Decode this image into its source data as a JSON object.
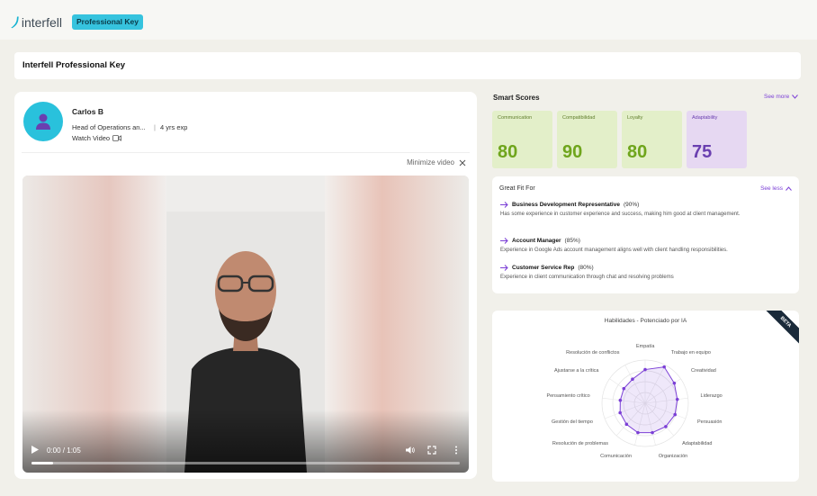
{
  "brand": {
    "name": "interfell",
    "tag": "Professional Key",
    "accent": "#36c3de"
  },
  "header": {
    "title": "Interfell Professional Key"
  },
  "candidate": {
    "name": "Carlos B",
    "role": "Head of Operations an...",
    "experience": "4 yrs exp",
    "watch_label": "Watch Video",
    "minimize_label": "Minimize video"
  },
  "video": {
    "time": "0:00 / 1:05",
    "progress": 0.05
  },
  "smart_scores": {
    "title": "Smart Scores",
    "see_more": "See more",
    "items": [
      {
        "label": "Communication",
        "value": "80"
      },
      {
        "label": "Compatibilidad",
        "value": "90"
      },
      {
        "label": "Loyalty",
        "value": "80"
      },
      {
        "label": "Adaptability",
        "value": "75"
      }
    ],
    "colors": {
      "green_bg": "#e3efc9",
      "green_text": "#6fa51c",
      "purple_bg": "#e6d8f2",
      "purple_text": "#6a3fb0"
    }
  },
  "great_fit": {
    "title": "Great Fit For",
    "see_less": "See less",
    "items": [
      {
        "role": "Business Development Representative",
        "pct": "(90%)",
        "desc": "Has some experience in customer experience and success, making him good at client management."
      },
      {
        "role": "Account Manager",
        "pct": "(85%)",
        "desc": "Experience in Google Ads account management aligns well with client handling responsibilities."
      },
      {
        "role": "Customer Service Rep",
        "pct": "(80%)",
        "desc": "Experience in client communication through chat and resolving problems"
      }
    ]
  },
  "radar": {
    "title": "Habilidades - Potenciado por IA",
    "badge": "BETA",
    "skills": [
      "Empatía",
      "Trabajo en equipo",
      "Creatividad",
      "Liderazgo",
      "Persuasión",
      "Adaptabilidad",
      "Organización",
      "Comunicación",
      "Resolución de problemas",
      "Gestión del tiempo",
      "Pensamiento crítico",
      "Ajustarse a la crítica",
      "Resolución de conflictos"
    ],
    "values": [
      0.78,
      0.95,
      0.82,
      0.75,
      0.74,
      0.72,
      0.7,
      0.7,
      0.65,
      0.62,
      0.58,
      0.6,
      0.63
    ],
    "color": "#7b3fd6"
  }
}
